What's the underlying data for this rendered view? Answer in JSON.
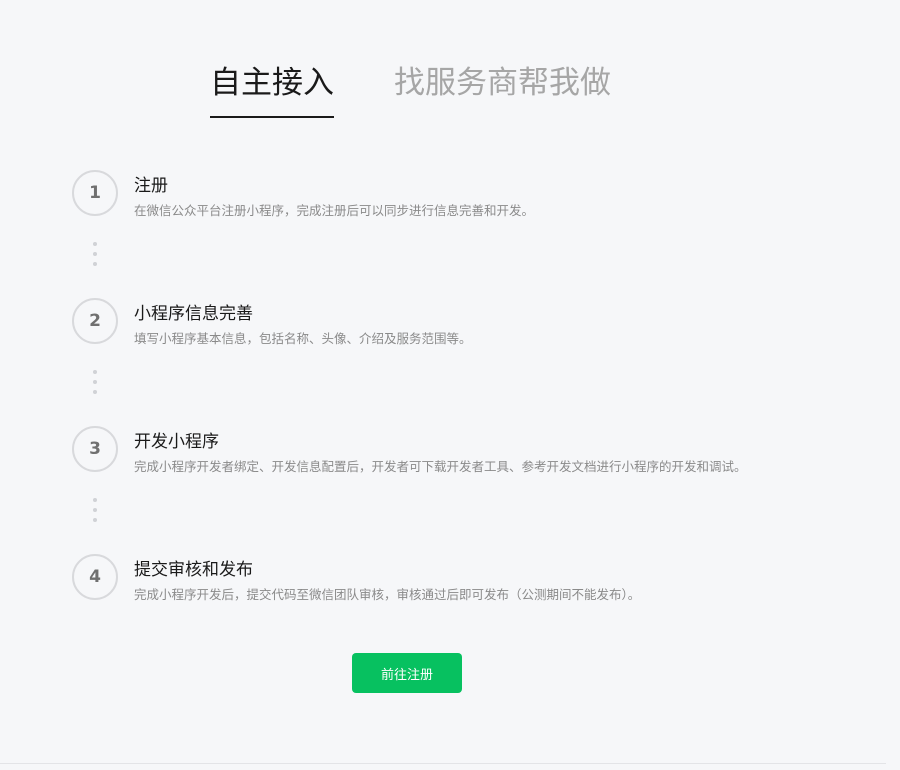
{
  "tabs": [
    {
      "label": "自主接入",
      "active": true
    },
    {
      "label": "找服务商帮我做",
      "active": false
    }
  ],
  "steps": [
    {
      "number": "1",
      "title": "注册",
      "description": "在微信公众平台注册小程序，完成注册后可以同步进行信息完善和开发。"
    },
    {
      "number": "2",
      "title": "小程序信息完善",
      "description": "填写小程序基本信息，包括名称、头像、介绍及服务范围等。"
    },
    {
      "number": "3",
      "title": "开发小程序",
      "description": "完成小程序开发者绑定、开发信息配置后，开发者可下载开发者工具、参考开发文档进行小程序的开发和调试。"
    },
    {
      "number": "4",
      "title": "提交审核和发布",
      "description": "完成小程序开发后，提交代码至微信团队审核，审核通过后即可发布（公测期间不能发布）。"
    }
  ],
  "cta": {
    "label": "前往注册"
  },
  "colors": {
    "accent": "#07c160",
    "tab_active": "#1a1a1a",
    "tab_inactive": "#a6a6a6"
  }
}
